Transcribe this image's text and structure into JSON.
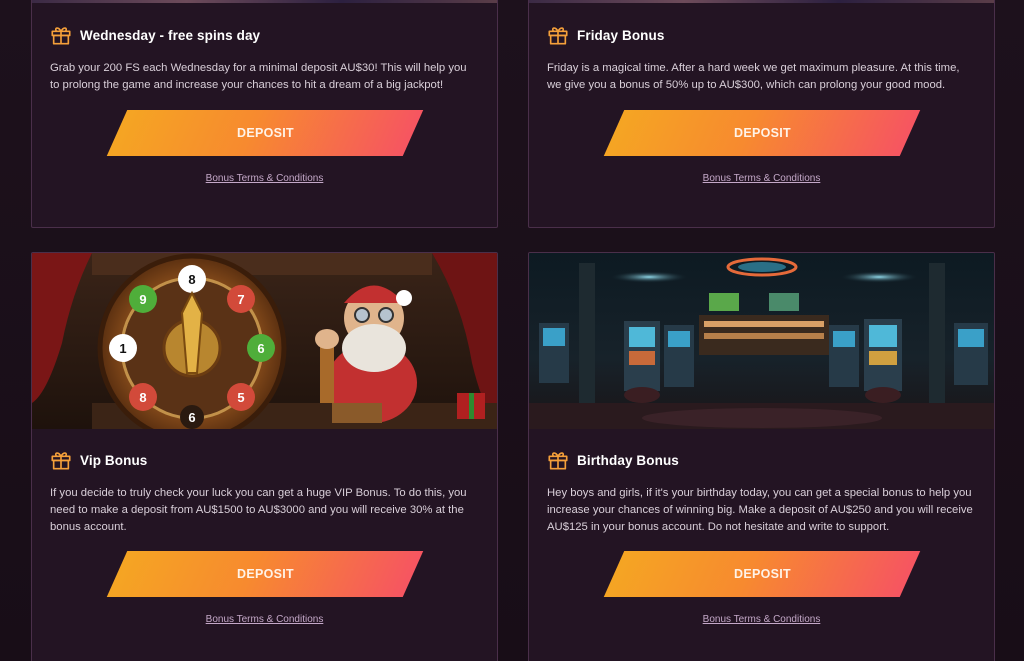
{
  "cards": [
    {
      "title": "Wednesday - free spins day",
      "description": "Grab your 200 FS each Wednesday for a minimal deposit AU$30! This will help you to prolong the game and increase your chances to hit a dream of a big jackpot!",
      "button": "DEPOSIT",
      "terms": "Bonus Terms & Conditions"
    },
    {
      "title": "Friday Bonus",
      "description": "Friday is a magical time. After a hard week we get maximum pleasure. At this time, we give you a bonus of 50% up to AU$300, which can prolong your good mood.",
      "button": "DEPOSIT",
      "terms": "Bonus Terms & Conditions"
    },
    {
      "title": "Vip Bonus",
      "description": "If you decide to truly check your luck you can get a huge VIP Bonus. To do this, you need to make a deposit from AU$1500 to AU$3000 and you will receive 30% at the bonus account.",
      "button": "DEPOSIT",
      "terms": "Bonus Terms & Conditions",
      "wheel_numbers": [
        "8",
        "7",
        "6",
        "5",
        "9",
        "1",
        "8",
        "6"
      ]
    },
    {
      "title": "Birthday Bonus",
      "description": "Hey boys and girls, if it's your birthday today, you can get a special bonus to help you increase your chances of winning big. Make a deposit of AU$250 and you will receive AU$125 in your bonus account. Do not hesitate and write to support.",
      "button": "DEPOSIT",
      "terms": "Bonus Terms & Conditions"
    }
  ],
  "icons": {
    "card_icon": "gift-icon"
  },
  "colors": {
    "background": "#1a0f1a",
    "card": "#231423",
    "border": "#4a2f4a",
    "gift_icon": "#f5a03a",
    "button_start": "#f5a523",
    "button_end": "#f65561"
  }
}
